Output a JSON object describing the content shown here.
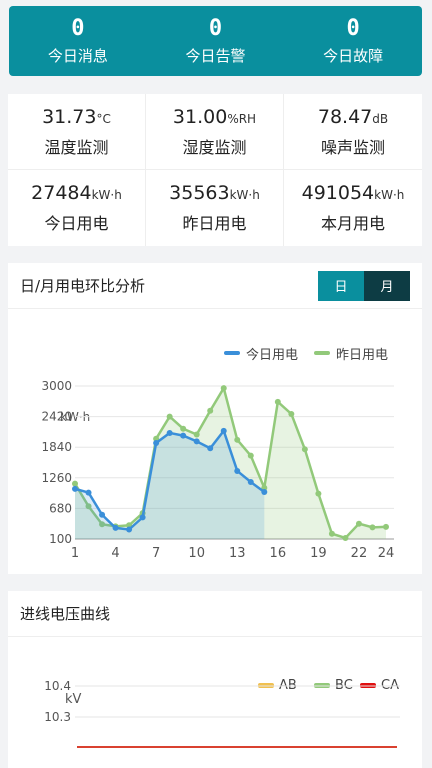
{
  "summary": [
    {
      "value": "0",
      "label": "今日消息"
    },
    {
      "value": "0",
      "label": "今日告警"
    },
    {
      "value": "0",
      "label": "今日故障"
    }
  ],
  "stats": [
    {
      "value": "31.73",
      "unit": "°C",
      "label": "温度监测"
    },
    {
      "value": "31.00",
      "unit": "%RH",
      "label": "湿度监测"
    },
    {
      "value": "78.47",
      "unit": "dB",
      "label": "噪声监测"
    },
    {
      "value": "27484",
      "unit": "kW·h",
      "label": "今日用电"
    },
    {
      "value": "35563",
      "unit": "kW·h",
      "label": "昨日用电"
    },
    {
      "value": "491054",
      "unit": "kW·h",
      "label": "本月用电"
    }
  ],
  "energy_panel": {
    "title": "日/月用电环比分析",
    "toggle_day": "日",
    "toggle_month": "月"
  },
  "voltage_panel": {
    "title": "进线电压曲线"
  },
  "colors": {
    "accent": "#0a8f9e",
    "today": "#3a8fd9",
    "yesterday": "#92c97a",
    "ab": "#f0c050",
    "bc": "#92c97a",
    "ca": "#e01010"
  },
  "chart_data": [
    {
      "type": "area",
      "ylabel": "kW·h",
      "ylim": [
        100,
        3000
      ],
      "yticks": [
        100,
        680,
        1260,
        1840,
        2420,
        3000
      ],
      "xticks": [
        1,
        4,
        7,
        10,
        13,
        16,
        19,
        22,
        24
      ],
      "x": [
        1,
        2,
        3,
        4,
        5,
        6,
        7,
        8,
        9,
        10,
        11,
        12,
        13,
        14,
        15,
        16,
        17,
        18,
        19,
        20,
        21,
        22,
        23,
        24
      ],
      "legend_position": "top-right",
      "series": [
        {
          "name": "今日用电",
          "values": [
            1050,
            980,
            560,
            310,
            280,
            510,
            1920,
            2110,
            2060,
            1950,
            1820,
            2150,
            1390,
            1180,
            990
          ]
        },
        {
          "name": "昨日用电",
          "values": [
            1150,
            720,
            380,
            340,
            360,
            590,
            2000,
            2420,
            2190,
            2080,
            2530,
            2960,
            1980,
            1680,
            1070,
            2700,
            2470,
            1800,
            960,
            200,
            120,
            390,
            320,
            330
          ]
        }
      ]
    },
    {
      "type": "line",
      "ylabel": "kV",
      "yticks": [
        10.3,
        10.4
      ],
      "legend_position": "top-right",
      "series": [
        {
          "name": "AB",
          "values": []
        },
        {
          "name": "BC",
          "values": []
        },
        {
          "name": "CA",
          "values": []
        }
      ]
    }
  ]
}
